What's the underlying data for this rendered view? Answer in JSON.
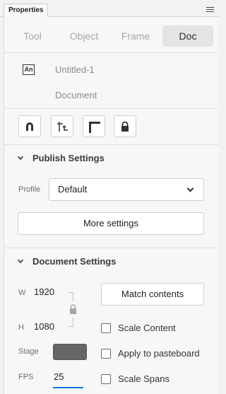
{
  "panel": {
    "title": "Properties"
  },
  "tabs": [
    {
      "label": "Tool",
      "active": false
    },
    {
      "label": "Object",
      "active": false
    },
    {
      "label": "Frame",
      "active": false
    },
    {
      "label": "Doc",
      "active": true
    }
  ],
  "document": {
    "icon_text": "An",
    "name": "Untitled-1",
    "type": "Document"
  },
  "toolbar": [
    "snap-magnet-icon",
    "align-to-stage-icon",
    "ruler-guides-icon",
    "lock-icon"
  ],
  "publish": {
    "heading": "Publish Settings",
    "profile_label": "Profile",
    "profile_value": "Default",
    "more_settings_label": "More settings"
  },
  "doc_settings": {
    "heading": "Document Settings",
    "width_label": "W",
    "width_value": "1920",
    "height_label": "H",
    "height_value": "1080",
    "match_contents_label": "Match contents",
    "scale_content_label": "Scale Content",
    "apply_pasteboard_label": "Apply to pasteboard",
    "scale_spans_label": "Scale Spans",
    "stage_label": "Stage",
    "stage_color": "#666666",
    "fps_label": "FPS",
    "fps_value": "25"
  },
  "colors": {
    "accent": "#1473e6",
    "panel_bg": "#f7f7f7"
  }
}
